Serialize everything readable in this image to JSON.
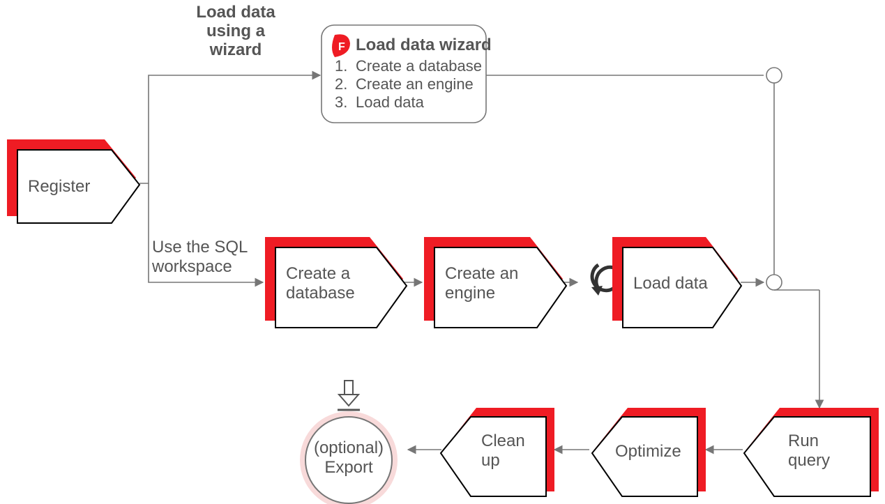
{
  "register": "Register",
  "wizard_caption_line1": "Load data",
  "wizard_caption_line2": "using a",
  "wizard_caption_line3": "wizard",
  "wizard_box_title": "Load data wizard",
  "wizard_box_items": [
    "Create a database",
    "Create an engine",
    "Load data"
  ],
  "sql_caption_line1": "Use the SQL",
  "sql_caption_line2": "workspace",
  "create_db_line1": "Create a",
  "create_db_line2": "database",
  "create_engine_line1": "Create an",
  "create_engine_line2": "engine",
  "load_data": "Load data",
  "run_query_line1": "Run",
  "run_query_line2": "query",
  "optimize": "Optimize",
  "cleanup_line1": "Clean",
  "cleanup_line2": "up",
  "export_line1": "(optional)",
  "export_line2": "Export",
  "colors": {
    "accent": "#ef1c24",
    "jct": "#767676",
    "txt": "#555"
  }
}
